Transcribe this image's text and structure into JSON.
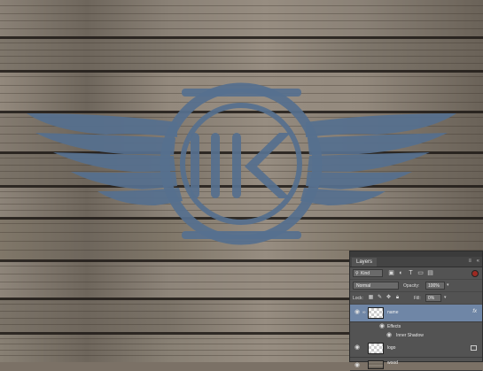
{
  "colors": {
    "logo": "#56708f",
    "wood_light": "#8c8378",
    "wood_dark": "#5e564d",
    "panel_bg": "#535353",
    "selected_layer": "#6f86a6"
  },
  "logo": {
    "monogram": "IIK"
  },
  "layers_panel": {
    "tab_label": "Layers",
    "kind_label": "Kind",
    "blend_mode": "Normal",
    "opacity_label": "Opacity:",
    "opacity_value": "100%",
    "lock_label": "Lock:",
    "fill_label": "Fill:",
    "fill_value": "0%",
    "layers": [
      {
        "name": "name",
        "fx": "fx",
        "effects_label": "Effects",
        "effect_items": [
          "Inner Shadow"
        ]
      },
      {
        "name": "logo"
      },
      {
        "name": "wood"
      }
    ],
    "icons": [
      "eye-icon",
      "link-icon",
      "lock-icon",
      "brush-icon",
      "move-icon",
      "smart-object-icon"
    ]
  }
}
